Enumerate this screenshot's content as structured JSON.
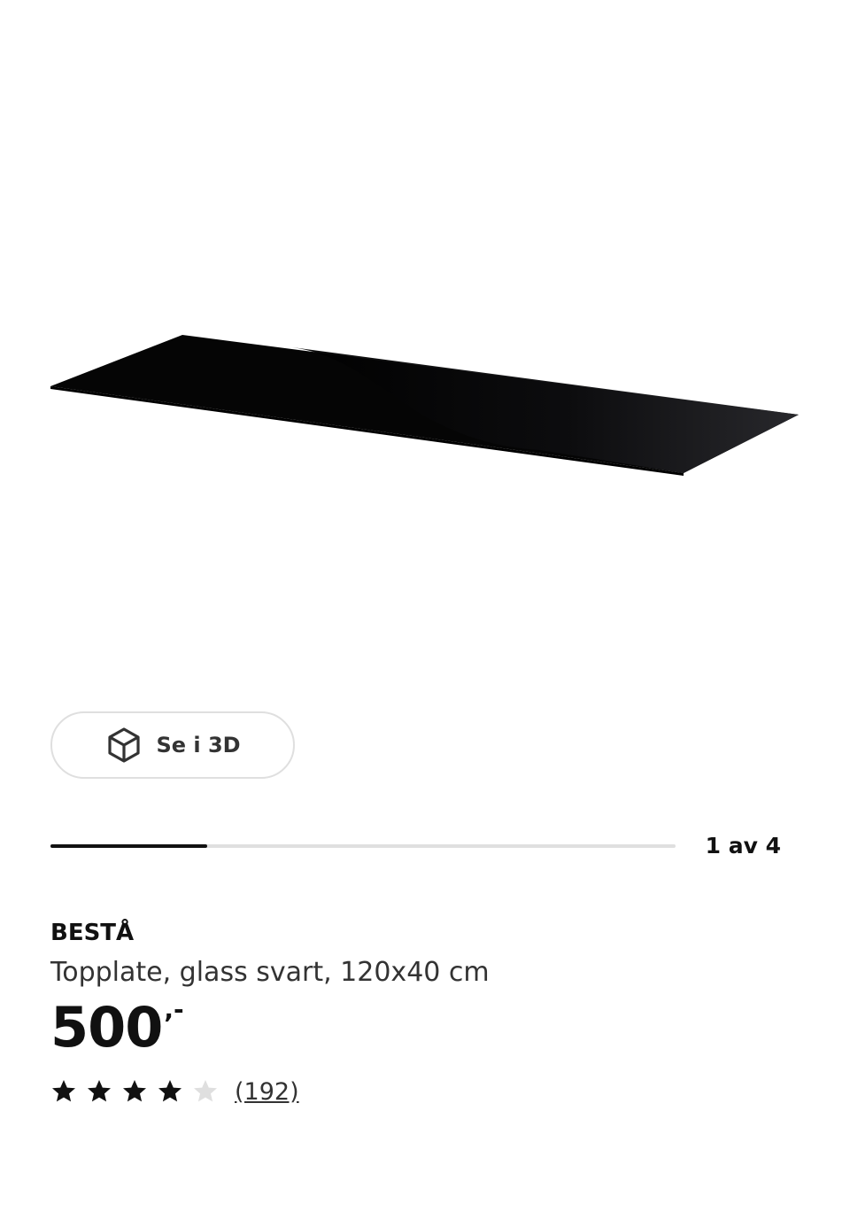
{
  "view_3d": {
    "label": "Se i 3D",
    "icon": "cube-3d-icon"
  },
  "carousel": {
    "counter": "1 av 4",
    "current": 1,
    "total": 4
  },
  "product": {
    "name": "BESTÅ",
    "description": "Topplate, glass svart, 120x40 cm",
    "price": "500",
    "price_suffix": ",-",
    "rating": 4,
    "rating_max": 5,
    "review_count": "(192)"
  },
  "colors": {
    "text": "#111111",
    "muted_text": "#333333",
    "border": "#dfdfdf",
    "star_filled": "#111111",
    "star_empty": "#dfdfdf",
    "product_glass": "#0a0a0a"
  }
}
